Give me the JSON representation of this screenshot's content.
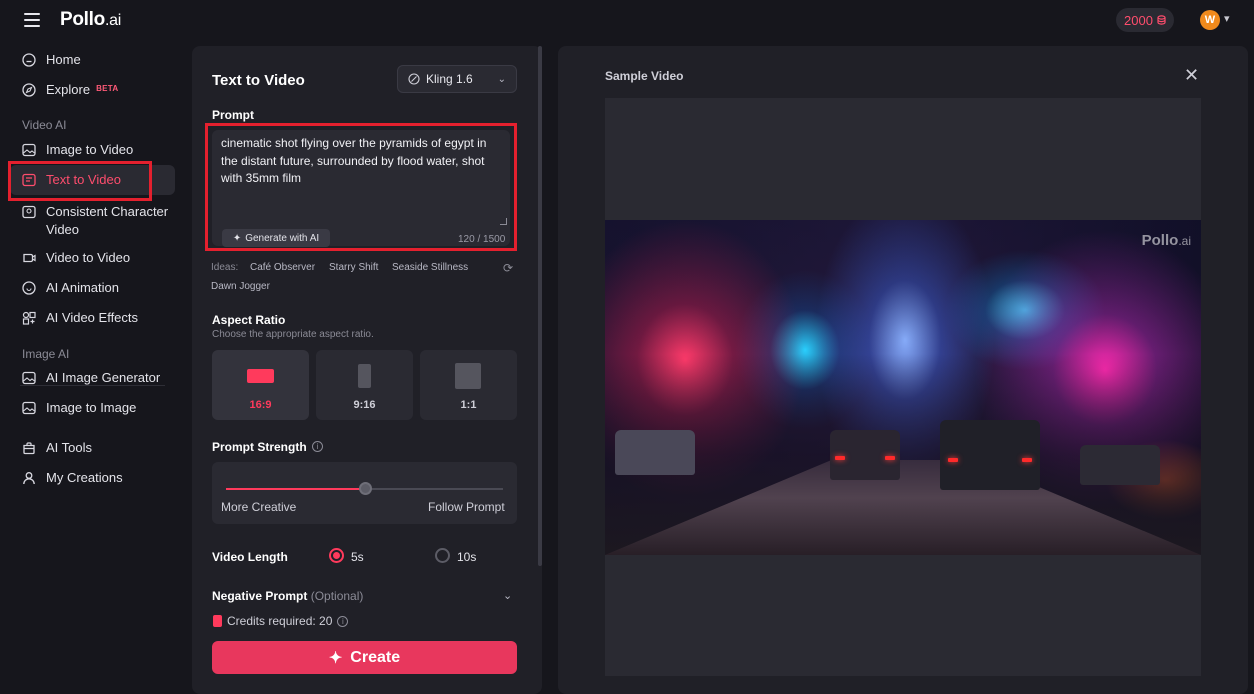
{
  "header": {
    "logo_main": "Pollo",
    "logo_suffix": ".ai",
    "credits": "2000",
    "avatar_initial": "W"
  },
  "sidebar": {
    "items": [
      {
        "label": "Home",
        "icon": "home-icon"
      },
      {
        "label": "Explore",
        "icon": "compass-icon",
        "badge": "BETA"
      },
      {
        "label": "Image to Video",
        "icon": "image-video-icon"
      },
      {
        "label": "Text to Video",
        "icon": "text-video-icon",
        "active": true
      },
      {
        "label": "Consistent Character",
        "label2": "Video",
        "icon": "character-icon"
      },
      {
        "label": "Video to Video",
        "icon": "video-video-icon"
      },
      {
        "label": "AI Animation",
        "icon": "animation-icon"
      },
      {
        "label": "AI Video Effects",
        "icon": "effects-icon"
      },
      {
        "label": "AI Image Generator",
        "icon": "image-gen-icon"
      },
      {
        "label": "Image to Image",
        "icon": "image-image-icon"
      },
      {
        "label": "AI Tools",
        "icon": "tools-icon"
      },
      {
        "label": "My Creations",
        "icon": "user-icon"
      }
    ],
    "sections": {
      "video_ai": "Video AI",
      "image_ai": "Image AI"
    }
  },
  "form": {
    "title": "Text to Video",
    "model": "Kling 1.6",
    "prompt_label": "Prompt",
    "prompt_value": "cinematic shot flying over the pyramids of egypt in the distant future, surrounded by flood water, shot with 35mm film",
    "generate_ai_label": "Generate with AI",
    "char_count": "120 / 1500",
    "ideas_label": "Ideas:",
    "ideas": [
      "Café Observer",
      "Starry Shift",
      "Seaside Stillness",
      "Dawn Jogger"
    ],
    "aspect_label": "Aspect Ratio",
    "aspect_hint": "Choose the appropriate aspect ratio.",
    "aspect_options": [
      {
        "label": "16:9",
        "selected": true
      },
      {
        "label": "9:16",
        "selected": false
      },
      {
        "label": "1:1",
        "selected": false
      }
    ],
    "strength_label": "Prompt Strength",
    "strength_value": 0.5,
    "strength_left": "More Creative",
    "strength_right": "Follow Prompt",
    "length_label": "Video Length",
    "length_options": [
      {
        "label": "5s",
        "selected": true
      },
      {
        "label": "10s",
        "selected": false
      }
    ],
    "negative_label": "Negative Prompt",
    "negative_optional": "(Optional)",
    "credits_required": "Credits required: 20",
    "create_label": "Create"
  },
  "preview": {
    "title": "Sample Video",
    "watermark_main": "Pollo",
    "watermark_suffix": ".ai"
  },
  "colors": {
    "accent": "#e8375d",
    "highlight_box": "#e4202e",
    "background": "#16161c",
    "panel": "#202027"
  }
}
